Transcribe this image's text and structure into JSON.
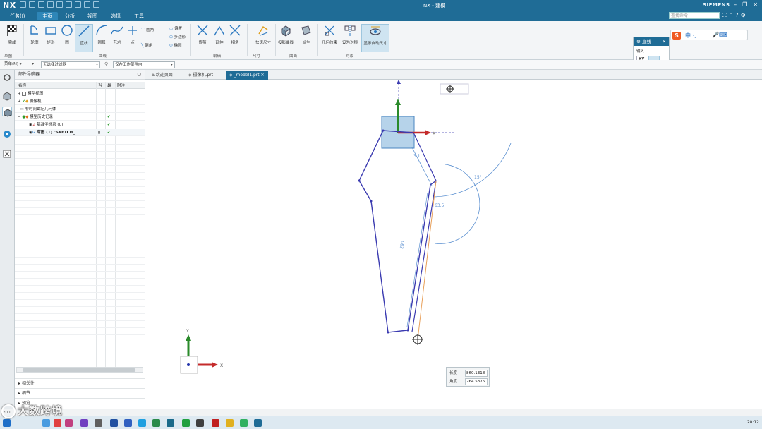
{
  "window": {
    "logo": "NX",
    "title": "NX - 建模"
  },
  "menu": {
    "tabs": [
      "任务(I)",
      "主页",
      "分析",
      "视图",
      "选择",
      "工具"
    ],
    "active_tab": "主页",
    "search_placeholder": "查找命令",
    "brand": "SIEMENS"
  },
  "ribbon": {
    "buttons": {
      "finish": "完成",
      "profile": "轮廓",
      "rectangle": "矩形",
      "circle": "圆",
      "line": "直线",
      "arc": "圆弧",
      "spline": "艺术",
      "point": "点",
      "trim": "修剪",
      "extend": "延伸",
      "fillet2": "拐角",
      "quick_dim": "快速尺寸",
      "convert": "投影曲线",
      "reference": "派生",
      "geometric": "几何约束",
      "set_symmetric": "设为对称",
      "show_dims": "显示自动尺寸"
    },
    "small": {
      "chamfer": "倒角",
      "offset": "偏置",
      "ellipse": "椭圆",
      "fillet": "圆角",
      "polygon": "多边形"
    },
    "groups": {
      "direct_sketch": "草图",
      "curve": "曲线",
      "edit": "编辑",
      "dimension": "尺寸",
      "surface": "曲面",
      "constraint": "约束"
    }
  },
  "selection": {
    "filter": "菜单(M) ▾",
    "type_filter": "无选择过滤器",
    "scope": "仅在工作部件内"
  },
  "navigator": {
    "title": "部件导航器",
    "columns": [
      "名称",
      "当",
      "最",
      "附注"
    ],
    "rows": [
      {
        "label": "模型视图",
        "indent": 1
      },
      {
        "label": "摄像机",
        "indent": 1
      },
      {
        "label": "非时间戳记几何体",
        "indent": 1
      },
      {
        "label": "模型历史记录",
        "indent": 1
      },
      {
        "label": "基准坐标系 (0)",
        "indent": 2
      },
      {
        "label": "草图 (1) \"SKETCH_...",
        "indent": 2
      }
    ],
    "panels": [
      "相关性",
      "细节",
      "预览"
    ]
  },
  "graphics_tabs": [
    {
      "label": "欢迎页面",
      "active": false
    },
    {
      "label": "摄像机.prt",
      "active": false
    },
    {
      "label": "_model1.prt",
      "active": true
    }
  ],
  "line_dialog": {
    "title": "直线",
    "input_label": "输入",
    "xy_label": "XY"
  },
  "length_popup": {
    "length_label": "长度",
    "length_value": "860.1318",
    "angle_label": "角度",
    "angle_value": "264.5376"
  },
  "sketch": {
    "dim_labels": [
      "3.1",
      "63.5",
      "290",
      "15°"
    ],
    "axis_x": "X",
    "axis_y": "Y"
  },
  "status": {
    "text": "200"
  },
  "taskbar": {
    "clock": "20:12"
  },
  "watermark": {
    "text": "大数跨境"
  },
  "colors": {
    "titlebar": "#1f6c96",
    "sketch_line": "#3a3ab0",
    "construction_line": "#e8a05a",
    "dimension": "#5a8fd0",
    "axis_x": "#c42b2b",
    "axis_y": "#2a8a2a"
  }
}
